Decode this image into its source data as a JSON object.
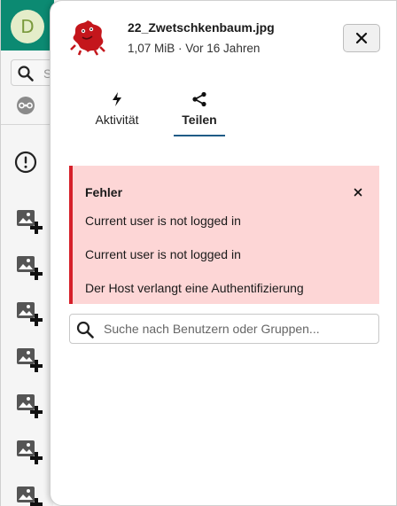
{
  "app_strip": {
    "avatar_letter": "D",
    "search_placeholder_partial": "S",
    "header_color": "#0c8a72",
    "icons": [
      "search-icon",
      "federated-link-icon",
      "alert-circle-icon",
      "image-plus-icon"
    ]
  },
  "sidebar": {
    "file": {
      "name": "22_Zwetschkenbaum.jpg",
      "size": "1,07 MiB",
      "separator": " · ",
      "age": "Vor 16 Jahren",
      "thumbnail_icon": "red-creature-icon"
    },
    "close_icon": "close-icon",
    "tabs": [
      {
        "label": "Aktivität",
        "icon": "lightning-icon",
        "active": false
      },
      {
        "label": "Teilen",
        "icon": "share-icon",
        "active": true
      }
    ],
    "error": {
      "title": "Fehler",
      "messages": [
        "Current user is not logged in",
        "Current user is not logged in",
        "Der Host verlangt eine Authentifizierung"
      ],
      "background": "#fdd6d6",
      "accent": "#d6202a"
    },
    "share_search": {
      "placeholder": "Suche nach Benutzern oder Gruppen..."
    }
  }
}
